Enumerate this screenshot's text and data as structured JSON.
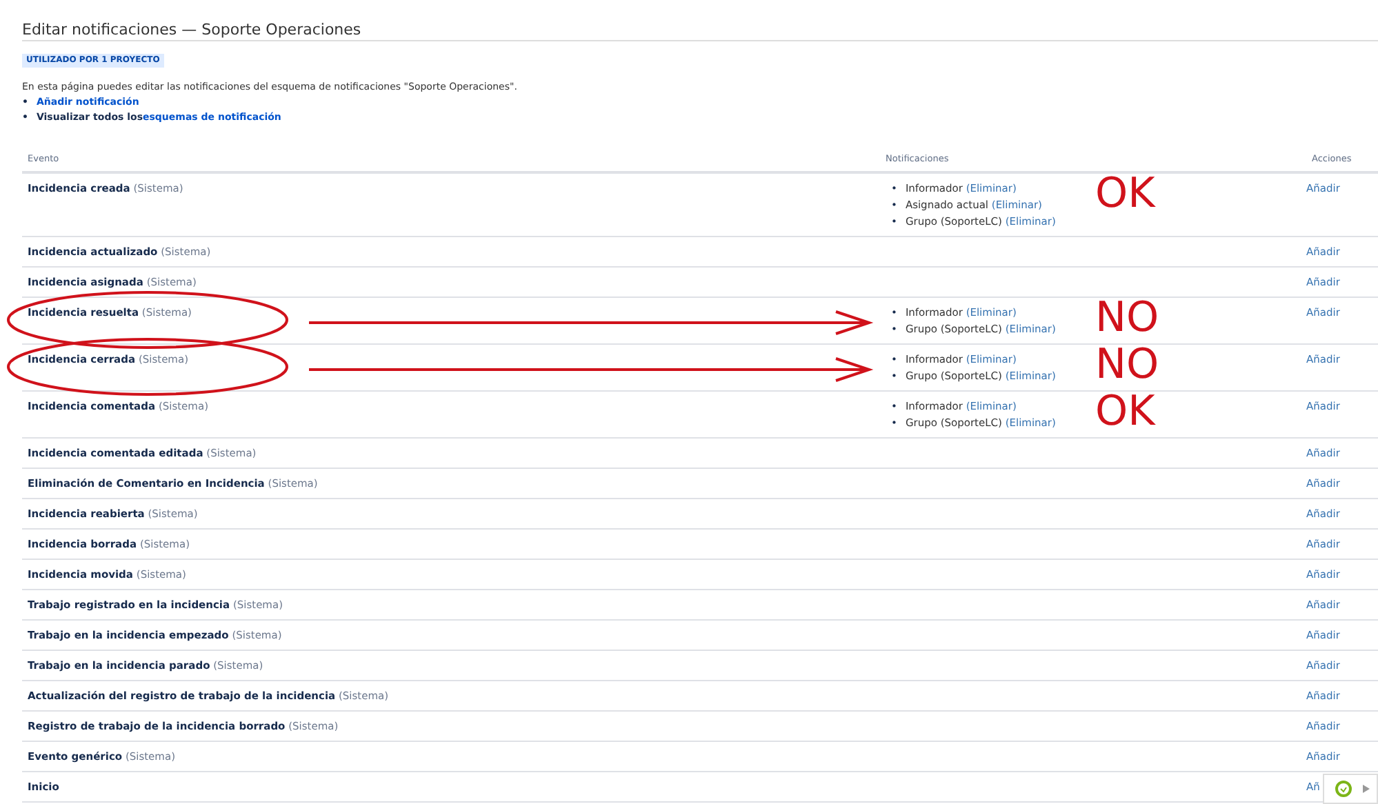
{
  "title": "Editar notificaciones — Soporte Operaciones",
  "badge": "UTILIZADO POR 1 PROYECTO",
  "description": "En esta página puedes editar las notificaciones del esquema de notificaciones \"Soporte Operaciones\".",
  "links": [
    {
      "bullet": "•",
      "link": "Añadir notificación"
    },
    {
      "bullet": "•",
      "prefix": "Visualizar todos los",
      "link": "esquemas de notificación"
    }
  ],
  "table": {
    "columns": [
      "Evento",
      "Notificaciones",
      "Acciones"
    ],
    "rows": [
      {
        "event": "Incidencia creada",
        "suffix": "(Sistema)",
        "notifications": [
          {
            "bullet": "•",
            "name": "Informador",
            "action": "(Eliminar)"
          },
          {
            "bullet": "•",
            "name": "Asignado actual",
            "action": "(Eliminar)"
          },
          {
            "bullet": "•",
            "name": "Grupo (SoporteLC)",
            "action": "(Eliminar)"
          }
        ],
        "action": "Añadir",
        "annotation": {
          "text": "OK"
        }
      },
      {
        "event": "Incidencia actualizado",
        "suffix": "(Sistema)",
        "action": "Añadir"
      },
      {
        "event": "Incidencia asignada",
        "suffix": "(Sistema)",
        "action": "Añadir"
      },
      {
        "event": "Incidencia resuelta",
        "suffix": "(Sistema)",
        "notifications": [
          {
            "bullet": "•",
            "name": "Informador",
            "action": "(Eliminar)"
          },
          {
            "bullet": "•",
            "name": "Grupo (SoporteLC)",
            "action": "(Eliminar)"
          }
        ],
        "action": "Añadir",
        "annotation": {
          "text": "NO",
          "circled": true,
          "arrow": true
        }
      },
      {
        "event": "Incidencia cerrada",
        "suffix": "(Sistema)",
        "notifications": [
          {
            "bullet": "•",
            "name": "Informador",
            "action": "(Eliminar)"
          },
          {
            "bullet": "•",
            "name": "Grupo (SoporteLC)",
            "action": "(Eliminar)"
          }
        ],
        "action": "Añadir",
        "annotation": {
          "text": "NO",
          "circled": true,
          "arrow": true
        }
      },
      {
        "event": "Incidencia comentada",
        "suffix": "(Sistema)",
        "notifications": [
          {
            "bullet": "•",
            "name": "Informador",
            "action": "(Eliminar)"
          },
          {
            "bullet": "•",
            "name": "Grupo (SoporteLC)",
            "action": "(Eliminar)"
          }
        ],
        "action": "Añadir",
        "annotation": {
          "text": "OK"
        }
      },
      {
        "event": "Incidencia comentada editada",
        "suffix": "(Sistema)",
        "action": "Añadir"
      },
      {
        "event": "Eliminación de Comentario en Incidencia",
        "suffix": "(Sistema)",
        "action": "Añadir"
      },
      {
        "event": "Incidencia reabierta",
        "suffix": "(Sistema)",
        "action": "Añadir"
      },
      {
        "event": "Incidencia borrada",
        "suffix": "(Sistema)",
        "action": "Añadir"
      },
      {
        "event": "Incidencia movida",
        "suffix": "(Sistema)",
        "action": "Añadir"
      },
      {
        "event": "Trabajo registrado en la incidencia",
        "suffix": "(Sistema)",
        "action": "Añadir"
      },
      {
        "event": "Trabajo en la incidencia empezado",
        "suffix": "(Sistema)",
        "action": "Añadir"
      },
      {
        "event": "Trabajo en la incidencia parado",
        "suffix": "(Sistema)",
        "action": "Añadir"
      },
      {
        "event": "Actualización del registro de trabajo de la incidencia",
        "suffix": "(Sistema)",
        "action": "Añadir"
      },
      {
        "event": "Registro de trabajo de la incidencia borrado",
        "suffix": "(Sistema)",
        "action": "Añadir"
      },
      {
        "event": "Evento genérico",
        "suffix": "(Sistema)",
        "action": "Añadir"
      },
      {
        "event": "Inicio",
        "action": "Añ"
      }
    ]
  }
}
